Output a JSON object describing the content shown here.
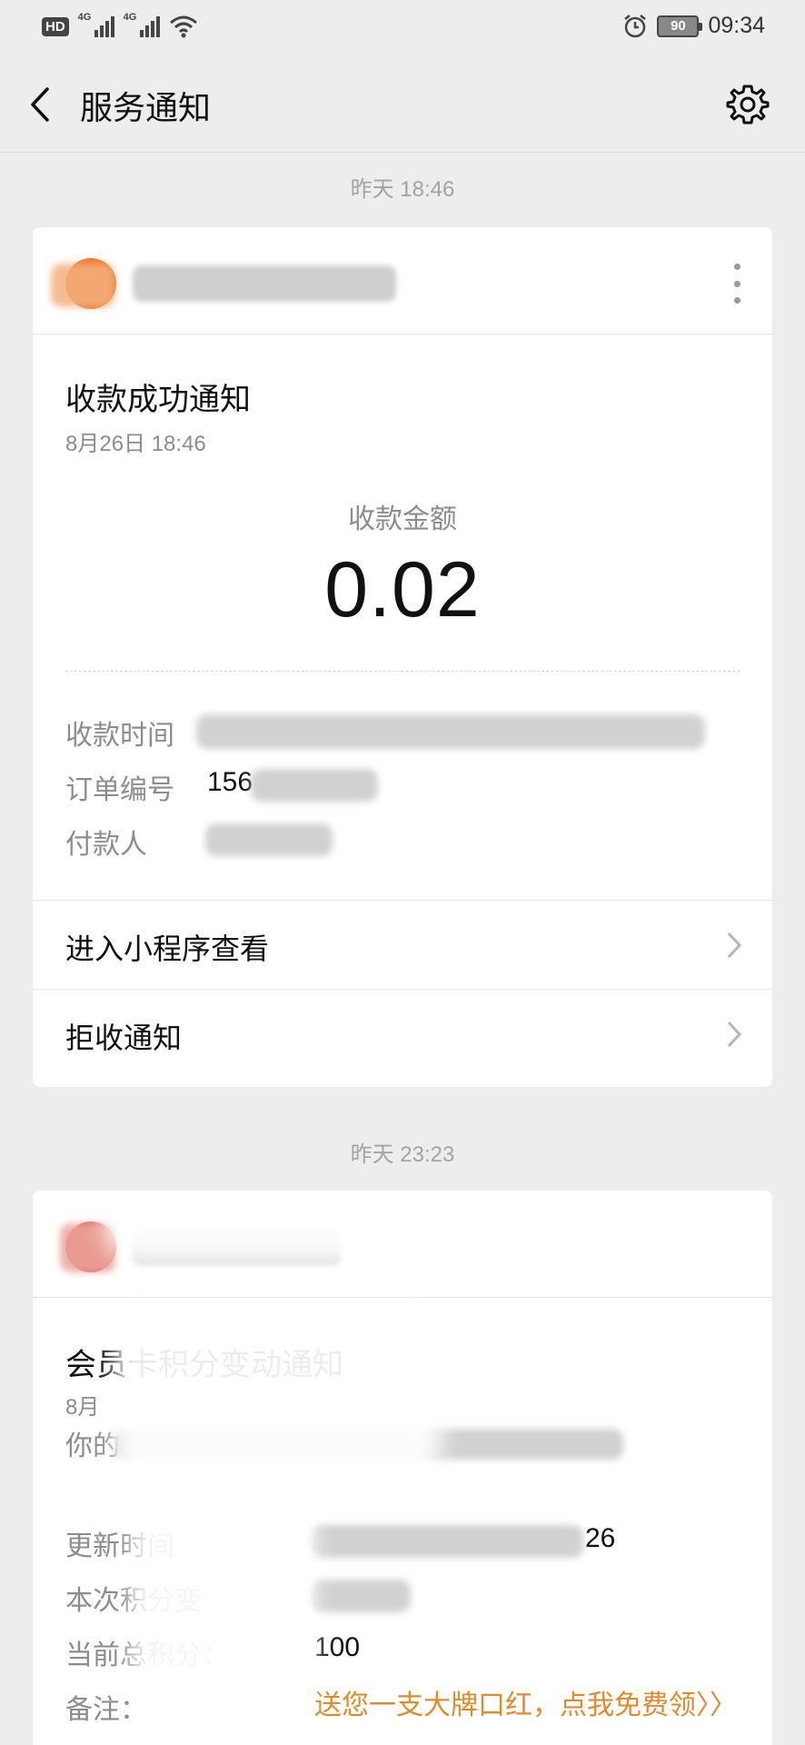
{
  "status_bar": {
    "hd_label": "HD",
    "net1": "4G",
    "net2": "4G",
    "battery": "90",
    "time": "09:34"
  },
  "header": {
    "title": "服务通知"
  },
  "messages": [
    {
      "time_label": "昨天 18:46",
      "title": "收款成功通知",
      "date": "8月26日  18:46",
      "amount_label": "收款金额",
      "amount": "0.02",
      "fields": [
        {
          "label": "收款时间",
          "value": ""
        },
        {
          "label": "订单编号",
          "value": "156"
        },
        {
          "label": "付款人",
          "value": ""
        }
      ],
      "links": [
        {
          "label": "进入小程序查看"
        },
        {
          "label": "拒收通知"
        }
      ]
    },
    {
      "time_label": "昨天 23:23",
      "title": "会员卡积分变动通知",
      "date": "8月",
      "desc": "你的",
      "fields": [
        {
          "label": "更新时间",
          "value": "26"
        },
        {
          "label": "本次积分变",
          "value": ""
        },
        {
          "label": "当前总积分：",
          "value": "100"
        },
        {
          "label": "备注：",
          "value": "送您一支大牌口红，点我免费领〉〉"
        }
      ]
    }
  ],
  "colors": {
    "background": "#ededed",
    "accent_orange": "#e08a2c",
    "avatar1": "#f07a2c",
    "avatar2": "#e56a5e"
  }
}
